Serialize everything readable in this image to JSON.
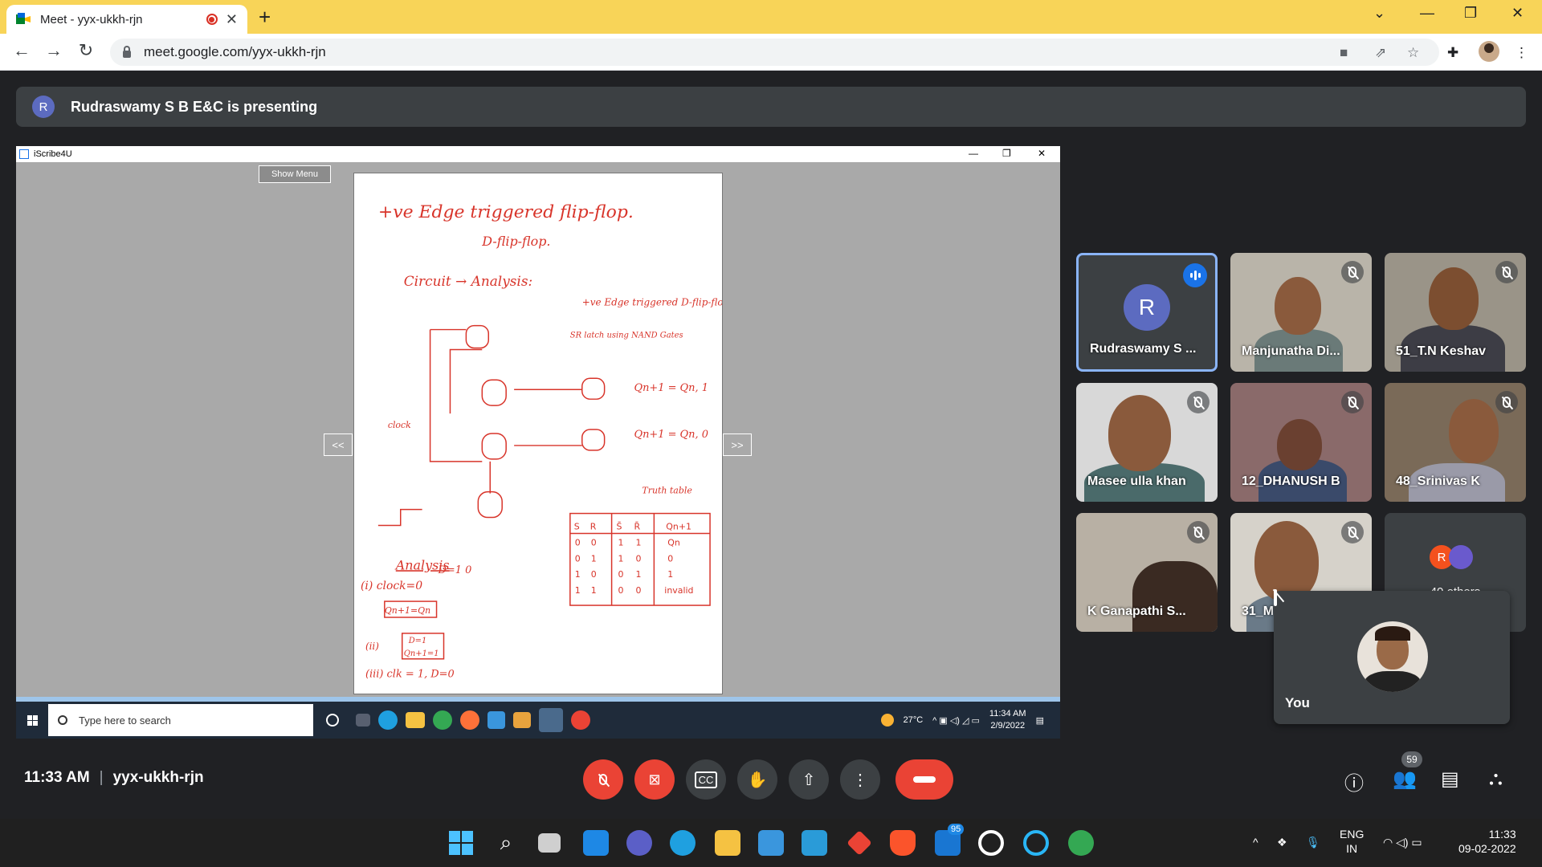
{
  "browser": {
    "tab_title": "Meet - yyx-ukkh-rjn",
    "url": "meet.google.com/yyx-ukkh-rjn"
  },
  "banner": {
    "avatar_letter": "R",
    "text": "Rudraswamy S B E&C is presenting"
  },
  "shared_screen": {
    "app_title": "iScribe4U",
    "show_menu": "Show Menu",
    "prev": "<<",
    "next": ">>",
    "notes": {
      "title": "+ve Edge triggered flip-flop.",
      "subtitle": "D-flip-flop.",
      "circuit": "Circuit → Analysis:",
      "right_title": "+ve Edge triggered D-flip-flop",
      "sr_latch": "SR latch using NAND Gates",
      "q_eq1": "Qn+1 = Qn, 1",
      "q_eq2": "Qn+1 = Qn, 0",
      "clock": "clock",
      "truth_table": "Truth table",
      "truth_headers": [
        "S",
        "R",
        "S̄",
        "R̄",
        "Qn+1"
      ],
      "truth_rows": [
        [
          "0",
          "0",
          "1",
          "1",
          "Qn"
        ],
        [
          "0",
          "1",
          "1",
          "0",
          "0"
        ],
        [
          "1",
          "0",
          "0",
          "1",
          "1"
        ],
        [
          "1",
          "1",
          "0",
          "0",
          "invalid"
        ]
      ],
      "analysis": "Analysis",
      "case1": "(i) clock=0",
      "case1_box": "Qn+1=Qn",
      "case2": "(ii)",
      "case2_box1": "D=1",
      "case2_box2": "Qn+1=1",
      "case3": "(iii) clk = 1, D=0",
      "d_label": "D=1 0"
    },
    "win_taskbar": {
      "search_placeholder": "Type here to search",
      "weather": "27°C",
      "time": "11:34 AM",
      "date": "2/9/2022"
    }
  },
  "participants": [
    {
      "name": "Rudraswamy S ...",
      "avatar": "R",
      "speaking": true
    },
    {
      "name": "Manjunatha Di...",
      "muted": true
    },
    {
      "name": "51_T.N Keshav",
      "muted": true
    },
    {
      "name": "Masee ulla khan",
      "muted": true
    },
    {
      "name": "12_DHANUSH B",
      "muted": true
    },
    {
      "name": "48_Srinivas K",
      "muted": true
    },
    {
      "name": "K Ganapathi S...",
      "muted": true
    },
    {
      "name": "31_M",
      "muted": true
    },
    {
      "name": "40 others",
      "avatar": "R"
    }
  ],
  "self_tile": {
    "name": "You"
  },
  "meet_bar": {
    "time": "11:33 AM",
    "separator": "|",
    "meeting_code": "yyx-ukkh-rjn",
    "people_count": "59"
  },
  "os_taskbar": {
    "lang": "ENG",
    "region": "IN",
    "time": "11:33",
    "date": "09-02-2022",
    "mail_badge": "95"
  },
  "colors": {
    "tabstrip": "#f8d458",
    "meet_bg": "#202124",
    "end_call": "#ea4335",
    "speaking": "#1a73e8"
  }
}
